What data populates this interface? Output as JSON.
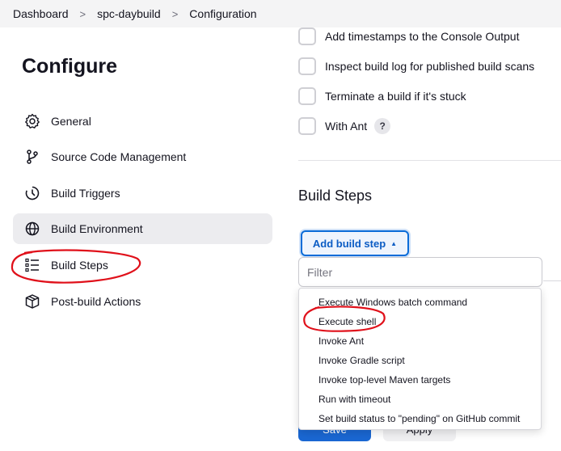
{
  "breadcrumb": {
    "items": [
      "Dashboard",
      "spc-daybuild",
      "Configuration"
    ],
    "separator": ">"
  },
  "sidebar": {
    "title": "Configure",
    "items": [
      {
        "label": "General",
        "icon": "gear-icon"
      },
      {
        "label": "Source Code Management",
        "icon": "branch-icon"
      },
      {
        "label": "Build Triggers",
        "icon": "timer-icon"
      },
      {
        "label": "Build Environment",
        "icon": "globe-icon",
        "active": true
      },
      {
        "label": "Build Steps",
        "icon": "list-icon"
      },
      {
        "label": "Post-build Actions",
        "icon": "package-icon"
      }
    ]
  },
  "options": [
    {
      "label": "Add timestamps to the Console Output",
      "checked": false
    },
    {
      "label": "Inspect build log for published build scans",
      "checked": false
    },
    {
      "label": "Terminate a build if it's stuck",
      "checked": false
    },
    {
      "label": "With Ant",
      "checked": false,
      "help": "?"
    }
  ],
  "build_steps": {
    "title": "Build Steps",
    "add_button": "Add build step",
    "filter_placeholder": "Filter",
    "menu_items": [
      "Execute Windows batch command",
      "Execute shell",
      "Invoke Ant",
      "Invoke Gradle script",
      "Invoke top-level Maven targets",
      "Run with timeout",
      "Set build status to \"pending\" on GitHub commit"
    ]
  },
  "footer": {
    "save_label": "Save",
    "apply_label": "Apply"
  },
  "colors": {
    "accent": "#0b6cd8",
    "annotation": "#e0101a",
    "active_bg": "#ececef"
  }
}
